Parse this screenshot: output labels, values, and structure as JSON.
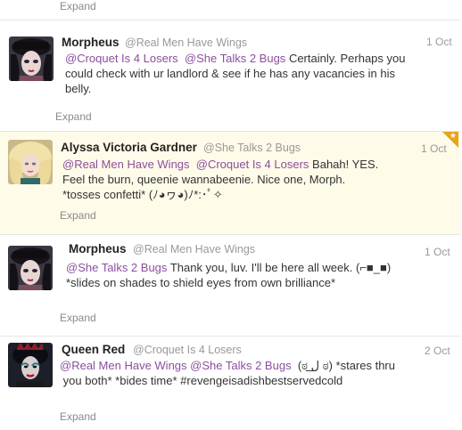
{
  "top": {
    "expand_label": "Expand"
  },
  "tweets": [
    {
      "name": "Morpheus",
      "handle": "@Real Men Have Wings",
      "date": "1 Oct",
      "mentions": [
        "@Croquet Is 4 Losers",
        "@She Talks 2 Bugs"
      ],
      "text_line1": "Certainly. Perhaps you",
      "text_line2": "could check with ur landlord & see if he has any vacancies in his",
      "text_line3": "belly.",
      "expand_label": "Expand"
    },
    {
      "name": "Alyssa Victoria Gardner",
      "handle": "@She Talks 2 Bugs",
      "date": "1 Oct",
      "mentions": [
        "@Real Men Have Wings",
        "@Croquet Is 4 Losers"
      ],
      "text_line1": "Bahah! YES.",
      "text_line2": "Feel the burn, queenie wannabeenie. Nice one, Morph.",
      "text_line3": "*tosses confetti* (ﾉ◕ヮ◕)ﾉ*:･ﾟ✧",
      "expand_label": "Expand"
    },
    {
      "name": "Morpheus",
      "handle": "@Real Men Have Wings",
      "date": "1 Oct",
      "mentions": [
        "@She Talks 2 Bugs"
      ],
      "text_line1": "Thank you, luv. I'll be here all week. (⌐■_■)",
      "text_line2": "*slides on shades to shield eyes from own brilliance*",
      "expand_label": "Expand"
    },
    {
      "name": "Queen Red",
      "handle": "@Croquet Is 4 Losers",
      "date": "2 Oct",
      "mentions": [
        "@Real Men Have Wings",
        "@She Talks 2 Bugs"
      ],
      "text_line1": "(ಠ ل͟ ಠ) *stares thru",
      "text_line2": "you both* *bides time* #revengeisadishbestservedcold",
      "expand_label": "Expand"
    }
  ],
  "colors": {
    "mention": "#8b4f9e",
    "highlight_bg": "#fffbe9",
    "corner": "#e8a31a"
  }
}
